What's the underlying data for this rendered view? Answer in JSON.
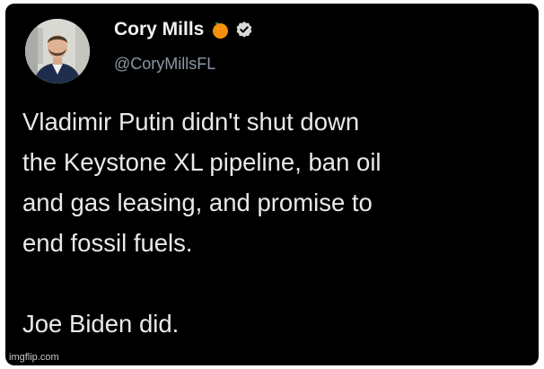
{
  "tweet": {
    "display_name": "Cory Mills",
    "handle": "@CoryMillsFL",
    "name_emoji": "orange-emoji",
    "verified_badge": "verified-icon",
    "text_lines": [
      "Vladimir Putin didn't shut down",
      "the Keystone XL pipeline, ban oil",
      "and gas leasing, and promise to",
      "end fossil fuels."
    ],
    "closing_line": "Joe Biden did."
  },
  "watermark": "imgflip.com",
  "colors": {
    "background": "#000000",
    "text": "#e7e9ea",
    "handle": "#8b98a5",
    "orange": "#f4900c"
  }
}
